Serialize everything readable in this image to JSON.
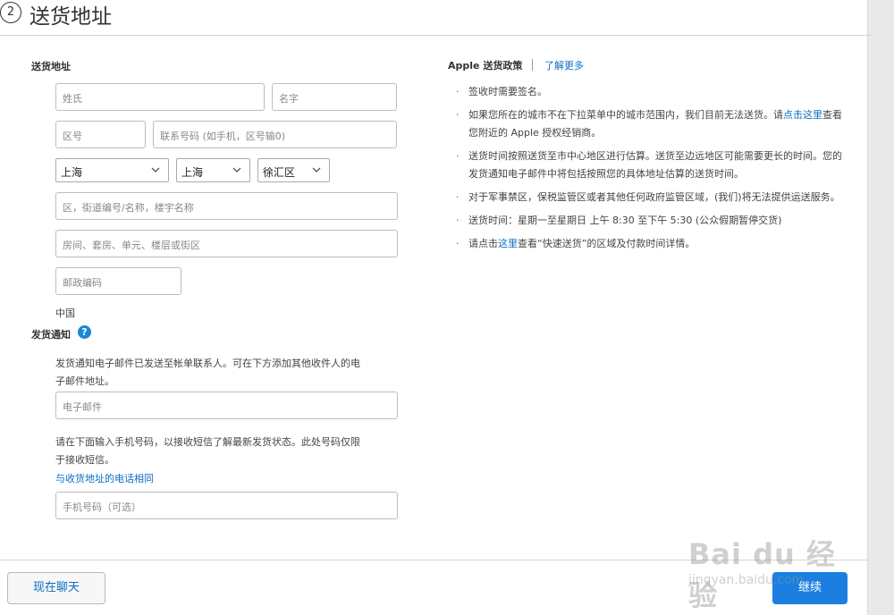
{
  "step": {
    "number": "2",
    "title": "送货地址"
  },
  "address": {
    "section_label": "送货地址",
    "last_name_placeholder": "姓氏",
    "first_name_placeholder": "名字",
    "area_code_placeholder": "区号",
    "phone_placeholder": "联系号码 (如手机，区号输0)",
    "province": "上海",
    "city": "上海",
    "district": "徐汇区",
    "street_placeholder": "区，街道编号/名称，楼宇名称",
    "room_placeholder": "房间、套房、单元、楼层或街区",
    "postcode_placeholder": "邮政编码",
    "country": "中国"
  },
  "notification": {
    "section_label": "发货通知",
    "help_glyph": "?",
    "email_desc_line1": "发货通知电子邮件已发送至帐单联系人。可在下方添加其他收件人的电",
    "email_desc_line2": "子邮件地址。",
    "email_placeholder": "电子邮件",
    "sms_desc_line1": "请在下面输入手机号码，以接收短信了解最新发货状态。此处号码仅限",
    "sms_desc_line2": "于接收短信。",
    "same_phone_link": "与收货地址的电话相同",
    "mobile_placeholder": "手机号码（可选）"
  },
  "policy": {
    "heading": "Apple 送货政策",
    "learn_more": "了解更多",
    "bullet1": "签收时需要签名。",
    "bullet2_part1": "如果您所在的城市不在下拉菜单中的城市范围内，我们目前无法送货。请",
    "bullet2_link": "点击这里",
    "bullet2_part2": "查看您附近的 Apple 授权经销商。",
    "bullet3": "送货时间按照送货至市中心地区进行估算。送货至边远地区可能需要更长的时间。您的发货通知电子邮件中将包括按照您的具体地址估算的送货时间。",
    "bullet4": "对于军事禁区，保税监管区或者其他任何政府监管区域，(我们)将无法提供运送服务。",
    "bullet5": "送货时间：星期一至星期日 上午 8:30 至下午 5:30 (公众假期暂停交货)",
    "bullet6_part1": "请点击",
    "bullet6_link": "这里",
    "bullet6_part2": "查看“快速送货”的区域及付款时间详情。"
  },
  "footer": {
    "chat_label": "现在聊天",
    "continue_label": "继续"
  },
  "watermark": {
    "main": "Bai du 经验",
    "sub": "jingyan.baidu.com"
  },
  "colors": {
    "accent": "#1a7fe0",
    "link": "#0b6cc4",
    "help": "#1a86d6"
  }
}
